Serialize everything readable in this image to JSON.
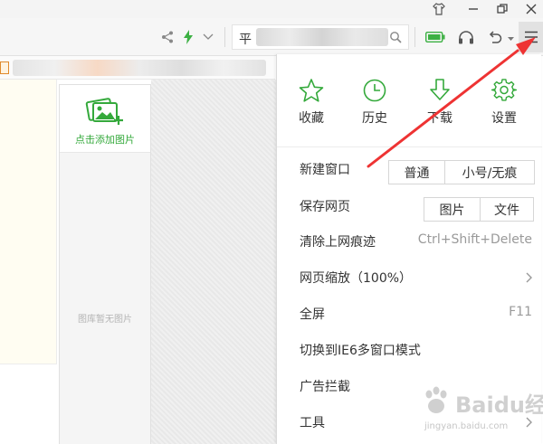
{
  "toolbar": {
    "address_text": "平"
  },
  "image_panel": {
    "add_label": "点击添加图片",
    "empty_text": "图库暂无图片"
  },
  "menu": {
    "quick_actions": [
      {
        "label": "收藏",
        "icon": "star-icon"
      },
      {
        "label": "历史",
        "icon": "clock-icon"
      },
      {
        "label": "下载",
        "icon": "download-icon"
      },
      {
        "label": "设置",
        "icon": "gear-icon"
      }
    ],
    "new_window": {
      "label": "新建窗口",
      "options": [
        "普通",
        "小号/无痕"
      ]
    },
    "save_page": {
      "label": "保存网页",
      "options": [
        "图片",
        "文件"
      ]
    },
    "clear_traces": {
      "label": "清除上网痕迹",
      "shortcut": "Ctrl+Shift+Delete"
    },
    "zoom": {
      "label": "网页缩放（100%）"
    },
    "fullscreen": {
      "label": "全屏",
      "shortcut": "F11"
    },
    "ie6_mode": {
      "label": "切换到IE6多窗口模式"
    },
    "ad_block": {
      "label": "广告拦截"
    },
    "tools": {
      "label": "工具"
    }
  },
  "colors": {
    "accent_green": "#34a93b",
    "annotation_red": "#ee3333"
  },
  "watermark": {
    "brand": "Baidu经验",
    "url": "jingyan.baidu.com"
  }
}
